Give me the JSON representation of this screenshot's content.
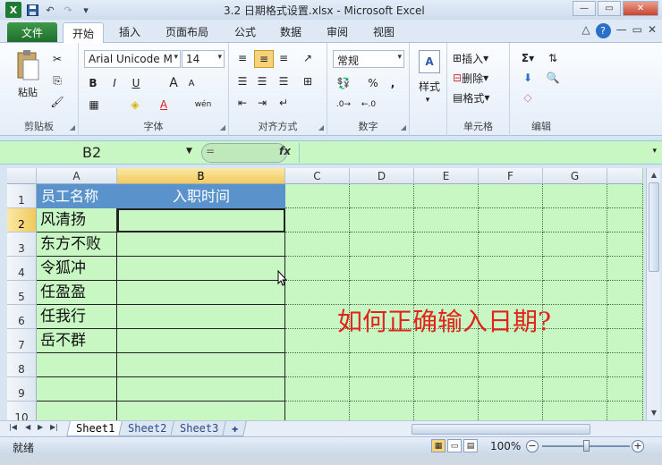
{
  "window": {
    "title": "3.2 日期格式设置.xlsx - Microsoft Excel",
    "logo": "X",
    "controls": [
      "—",
      "▭",
      "✕",
      "—",
      "▭",
      "✕"
    ]
  },
  "ribbon_tabs": {
    "file": "文件",
    "items": [
      "开始",
      "插入",
      "页面布局",
      "公式",
      "数据",
      "审阅",
      "视图"
    ],
    "active": "开始"
  },
  "groups": {
    "clipboard": {
      "label": "剪贴板",
      "paste": "粘贴"
    },
    "font": {
      "label": "字体",
      "name": "Arial Unicode M",
      "size": "14",
      "bold": "B",
      "italic": "I",
      "underline": "U",
      "grow": "A",
      "shrink": "A",
      "phonetic": "wén"
    },
    "alignment": {
      "label": "对齐方式"
    },
    "number": {
      "label": "数字",
      "format": "常规",
      "percent": "%",
      "comma": ","
    },
    "styles": {
      "label": "样式"
    },
    "cells": {
      "label": "单元格",
      "insert": "插入",
      "delete": "删除",
      "format": "格式"
    },
    "editing": {
      "label": "编辑",
      "sigma": "Σ"
    }
  },
  "formula_bar": {
    "name_box": "B2",
    "fx": "fx",
    "eq": "=",
    "value": ""
  },
  "columns": [
    "A",
    "B",
    "C",
    "D",
    "E",
    "F",
    "G"
  ],
  "rows": [
    "1",
    "2",
    "3",
    "4",
    "5",
    "6",
    "7",
    "8",
    "9",
    "10"
  ],
  "header_row": [
    "员工名称",
    "入职时间"
  ],
  "names": [
    "风清扬",
    "东方不败",
    "令狐冲",
    "任盈盈",
    "任我行",
    "岳不群"
  ],
  "overlay_text": "如何正确输入日期?",
  "sheet_tabs": [
    "Sheet1",
    "Sheet2",
    "Sheet3"
  ],
  "status": {
    "ready": "就绪",
    "zoom": "100%",
    "zoom_out": "−",
    "zoom_in": "+"
  }
}
